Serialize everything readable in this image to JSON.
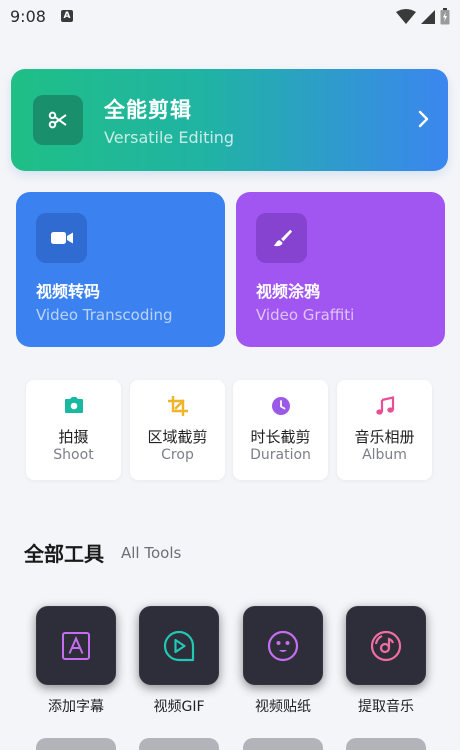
{
  "status_bar": {
    "time": "9:08",
    "badge": "A"
  },
  "banner": {
    "title": "全能剪辑",
    "subtitle": "Versatile Editing",
    "icon": "scissors-icon"
  },
  "cards": [
    {
      "title": "视频转码",
      "subtitle": "Video Transcoding",
      "icon": "video-camera-icon",
      "color": "#3b82f0"
    },
    {
      "title": "视频涂鸦",
      "subtitle": "Video Graffiti",
      "icon": "brush-icon",
      "color": "#a156f2"
    }
  ],
  "tiles": [
    {
      "cn": "拍摄",
      "en": "Shoot",
      "icon": "camera-icon",
      "color": "#19b8a0"
    },
    {
      "cn": "区域截剪",
      "en": "Crop",
      "icon": "crop-icon",
      "color": "#f0b429"
    },
    {
      "cn": "时长截剪",
      "en": "Duration",
      "icon": "clock-icon",
      "color": "#9b59e8"
    },
    {
      "cn": "音乐相册",
      "en": "Album",
      "icon": "music-note-icon",
      "color": "#e84f98"
    }
  ],
  "section": {
    "title": "全部工具",
    "subtitle": "All Tools"
  },
  "tools": [
    {
      "label": "添加字幕",
      "icon": "subtitle-a-icon",
      "color": "#c56ef0"
    },
    {
      "label": "视频GIF",
      "icon": "play-circle-icon",
      "color": "#1fc9b3"
    },
    {
      "label": "视频贴纸",
      "icon": "smiley-icon",
      "color": "#c56ef0"
    },
    {
      "label": "提取音乐",
      "icon": "music-disc-icon",
      "color": "#f06fa0"
    }
  ]
}
